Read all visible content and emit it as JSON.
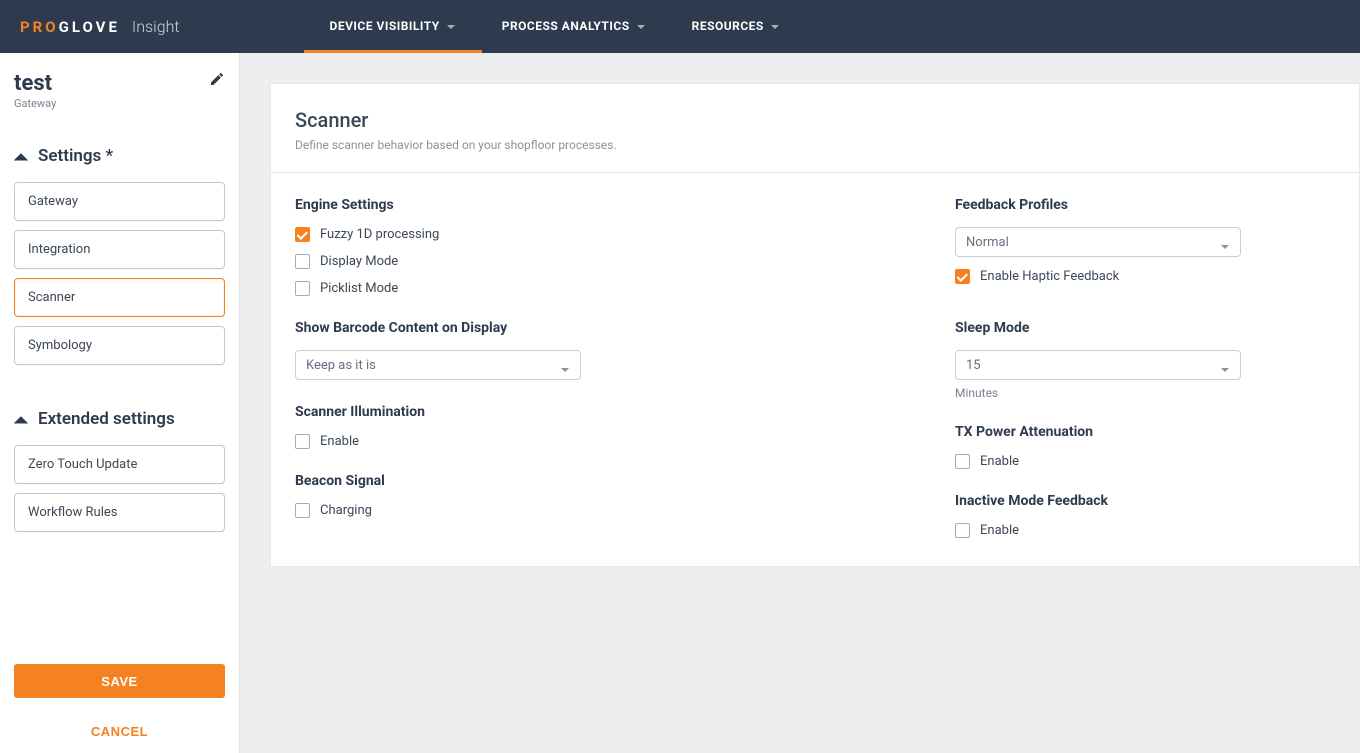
{
  "brand": {
    "pro": "PRO",
    "glove": "GLOVE",
    "product": "Insight"
  },
  "nav": {
    "device_visibility": "DEVICE VISIBILITY",
    "process_analytics": "PROCESS ANALYTICS",
    "resources": "RESOURCES"
  },
  "sidebar": {
    "title": "test",
    "subtitle": "Gateway",
    "settings_label": "Settings *",
    "extended_label": "Extended settings",
    "items": {
      "gateway": "Gateway",
      "integration": "Integration",
      "scanner": "Scanner",
      "symbology": "Symbology"
    },
    "extended_items": {
      "ztu": "Zero Touch Update",
      "workflow": "Workflow Rules"
    },
    "save": "SAVE",
    "cancel": "CANCEL"
  },
  "panel": {
    "title": "Scanner",
    "desc": "Define scanner behavior based on your shopfloor processes."
  },
  "settings": {
    "engine": {
      "title": "Engine Settings",
      "fuzzy": "Fuzzy 1D processing",
      "display_mode": "Display Mode",
      "picklist_mode": "Picklist Mode"
    },
    "barcode": {
      "title": "Show Barcode Content on Display",
      "value": "Keep as it is"
    },
    "illumination": {
      "title": "Scanner Illumination",
      "enable": "Enable"
    },
    "beacon": {
      "title": "Beacon Signal",
      "charging": "Charging"
    },
    "feedback": {
      "title": "Feedback Profiles",
      "value": "Normal",
      "haptic": "Enable Haptic Feedback"
    },
    "sleep": {
      "title": "Sleep Mode",
      "value": "15",
      "unit": "Minutes"
    },
    "txpower": {
      "title": "TX Power Attenuation",
      "enable": "Enable"
    },
    "inactive": {
      "title": "Inactive Mode Feedback",
      "enable": "Enable"
    }
  }
}
